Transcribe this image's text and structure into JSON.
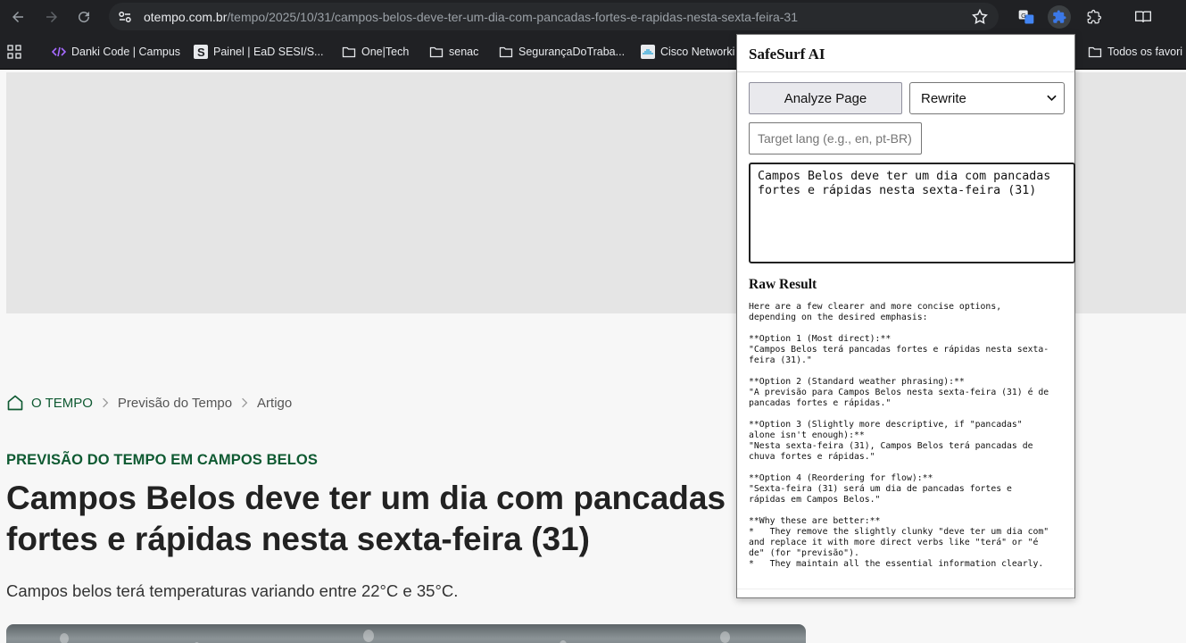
{
  "browser": {
    "url_host": "otempo.com.br",
    "url_path": "/tempo/2025/10/31/campos-belos-deve-ter-um-dia-com-pancadas-fortes-e-rapidas-nesta-sexta-feira-31"
  },
  "bookmarks": [
    {
      "label": "Danki Code | Campus",
      "icon": "code-icon"
    },
    {
      "label": "Painel | EaD SESI/S...",
      "icon": "sesi-logo-icon"
    },
    {
      "label": "One|Tech",
      "icon": "folder-icon"
    },
    {
      "label": "senac",
      "icon": "folder-icon"
    },
    {
      "label": "SegurançaDoTraba...",
      "icon": "folder-icon"
    },
    {
      "label": "Cisco Networki",
      "icon": "cisco-logo-icon"
    },
    {
      "label": "Todos os favori",
      "icon": "folder-icon"
    }
  ],
  "article": {
    "breadcrumb": [
      "O TEMPO",
      "Previsão do Tempo",
      "Artigo"
    ],
    "kicker": "PREVISÃO DO TEMPO EM CAMPOS BELOS",
    "headline": "Campos Belos deve ter um dia com pancadas fortes e rápidas nesta sexta-feira (31)",
    "subhead": "Campos belos terá temperaturas variando entre 22°C e 35°C."
  },
  "popup": {
    "title": "SafeSurf AI",
    "analyze_label": "Analyze Page",
    "mode_value": "Rewrite",
    "lang_placeholder": "Target lang (e.g., en, pt-BR)",
    "input_text": "Campos Belos deve ter um dia com pancadas fortes e rápidas nesta sexta-feira (31)",
    "raw_title": "Raw Result",
    "raw_result": "Here are a few clearer and more concise options,\ndepending on the desired emphasis:\n\n**Option 1 (Most direct):**\n\"Campos Belos terá pancadas fortes e rápidas nesta sexta-\nfeira (31).\"\n\n**Option 2 (Standard weather phrasing):**\n\"A previsão para Campos Belos nesta sexta-feira (31) é de\npancadas fortes e rápidas.\"\n\n**Option 3 (Slightly more descriptive, if \"pancadas\"\nalone isn't enough):**\n\"Nesta sexta-feira (31), Campos Belos terá pancadas de\nchuva fortes e rápidas.\"\n\n**Option 4 (Reordering for flow):**\n\"Sexta-feira (31) será um dia de pancadas fortes e\nrápidas em Campos Belos.\"\n\n**Why these are better:**\n*   They remove the slightly clunky \"deve ter um dia com\"\nand replace it with more direct verbs like \"terá\" or \"é\nde\" (for \"previsão\").\n*   They maintain all the essential information clearly."
  },
  "colors": {
    "accent_green": "#0f5a32",
    "chrome_dark": "#202124",
    "extension_active": "#3b78e7"
  }
}
